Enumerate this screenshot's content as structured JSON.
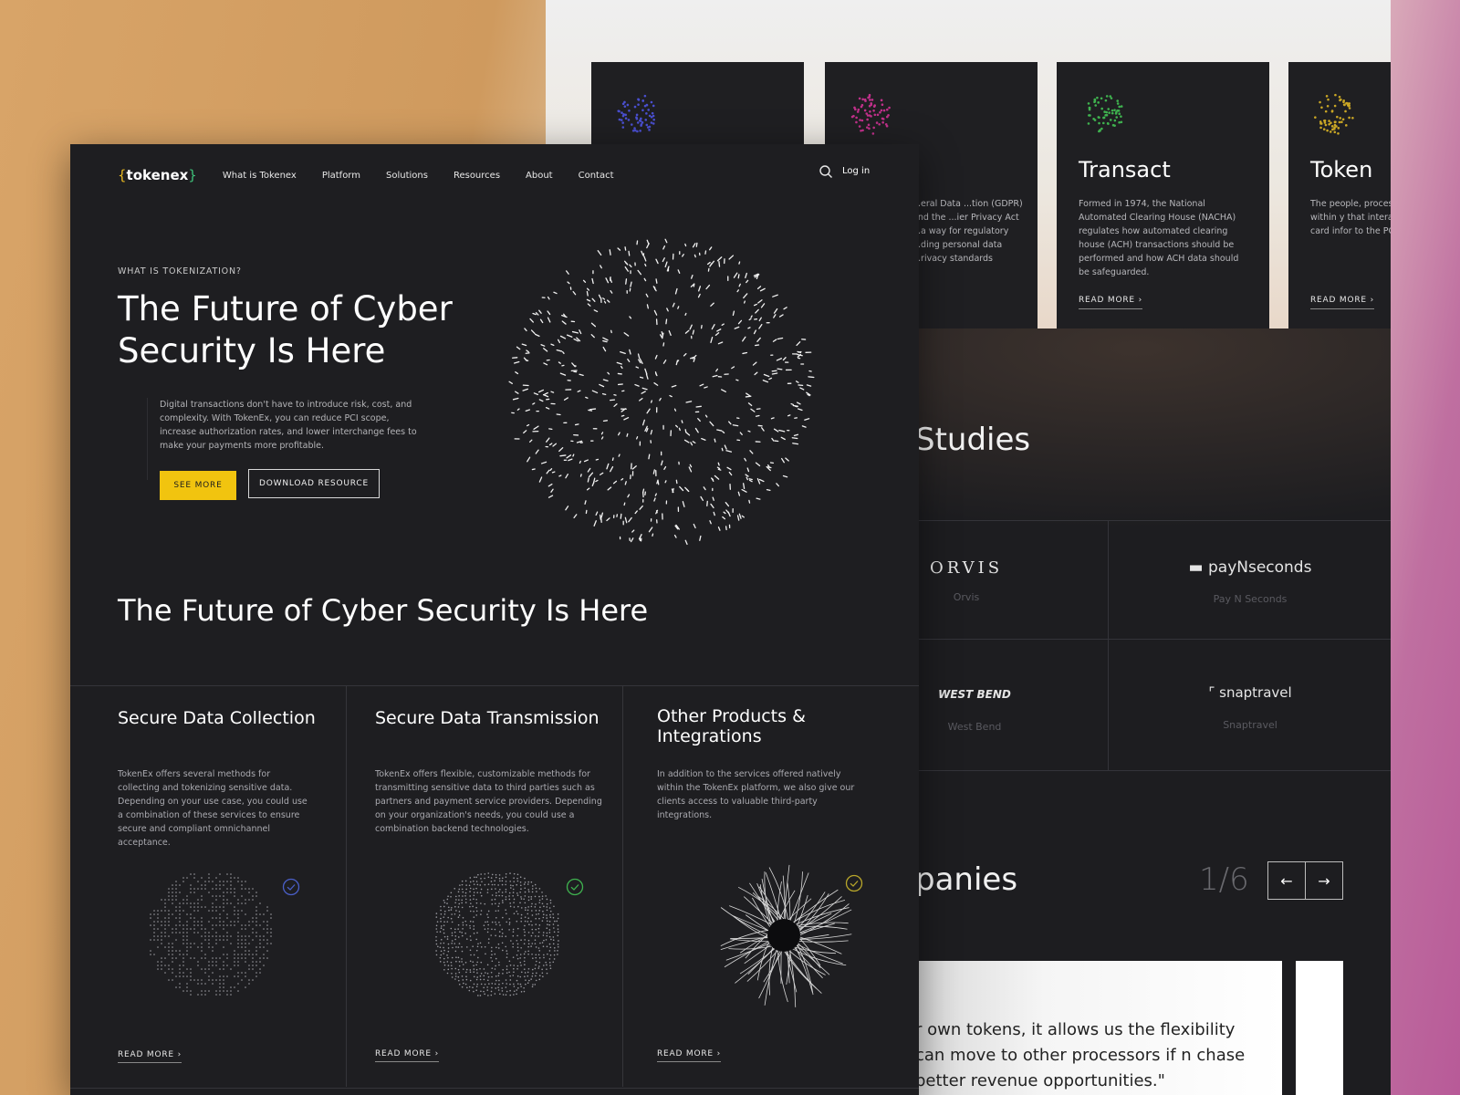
{
  "nav": {
    "brand": {
      "open": "{",
      "name": "tokenex",
      "close": "}"
    },
    "items": [
      "What is Tokenex",
      "Platform",
      "Solutions",
      "Resources",
      "About",
      "Contact"
    ],
    "login": "Log in"
  },
  "hero": {
    "eyebrow": "WHAT IS TOKENIZATION?",
    "title": "The Future of Cyber Security Is Here",
    "description": "Digital transactions don't have to introduce risk, cost, and complexity. With TokenEx, you can reduce PCI scope, increase authorization rates, and lower interchange fees to make your payments more profitable.",
    "primary_button": "SEE MORE",
    "secondary_button": "DOWNLOAD RESOURCE"
  },
  "section_title": "The Future of Cyber Security Is Here",
  "features": [
    {
      "title": "Secure Data Collection",
      "description": "TokenEx offers several methods for collecting and tokenizing sensitive data. Depending on your use case, you could use a combination of these services to ensure secure and compliant omnichannel acceptance.",
      "link": "READ MORE",
      "check_color": "#4a5fc8"
    },
    {
      "title": "Secure Data Transmission",
      "description": "TokenEx offers flexible, customizable methods for transmitting sensitive data to third parties such as partners and payment service providers. Depending on your organization's needs, you could use a combination backend technologies.",
      "link": "READ MORE",
      "check_color": "#3fb24f"
    },
    {
      "title": "Other Products & Integrations",
      "description": "In addition to the services offered natively within the TokenEx platform, we also give our clients access to valuable third-party integrations.",
      "link": "READ MORE",
      "check_color": "#b8a62a"
    }
  ],
  "cards": [
    {
      "title": "",
      "description": "",
      "link": "",
      "icon_color": "#4a4fd0"
    },
    {
      "title": "",
      "description": "...eral Data ...tion (GDPR) and the ...ier Privacy Act ...a way for regulatory ...ding personal data ...rivacy standards",
      "link": "",
      "icon_color": "#c0308a"
    },
    {
      "title": "Transact",
      "description": "Formed in 1974, the National Automated Clearing House (NACHA) regulates how automated clearing house (ACH) transactions should be performed and how ACH data should be safeguarded.",
      "link": "READ MORE",
      "icon_color": "#3fb24f"
    },
    {
      "title": "Token",
      "description": "The people, process technology within y that interact with o payment card infor to the PCI DSS.",
      "link": "READ MORE",
      "icon_color": "#c9a625"
    }
  ],
  "case_studies": {
    "heading": "Studies",
    "logos": [
      {
        "logo": "ORVIS",
        "name": "Orvis"
      },
      {
        "logo": "payNseconds",
        "name": "Pay N Seconds"
      },
      {
        "logo": "WEST BEND",
        "name": "West Bend"
      },
      {
        "logo": "snaptravel",
        "name": "Snaptravel"
      }
    ]
  },
  "companies": {
    "heading": "panies",
    "pager": "1/6",
    "prev": "←",
    "next": "→",
    "quote": "r own tokens, it allows us the flexibility can move to other processors if n chase better revenue opportunities.\""
  }
}
